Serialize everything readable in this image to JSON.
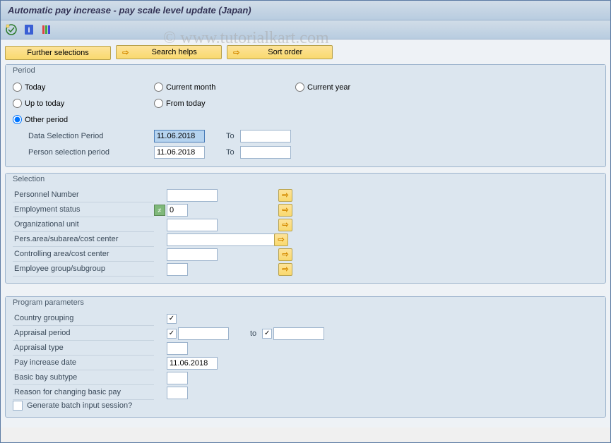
{
  "title": "Automatic pay increase - pay scale level update (Japan)",
  "watermark": "© www.tutorialkart.com",
  "buttons": {
    "further": "Further selections",
    "search": "Search helps",
    "sort": "Sort order"
  },
  "period": {
    "legend": "Period",
    "today": "Today",
    "current_month": "Current month",
    "current_year": "Current year",
    "up_to_today": "Up to today",
    "from_today": "From today",
    "other_period": "Other period",
    "data_sel_label": "Data Selection Period",
    "data_sel_from": "11.06.2018",
    "data_sel_to": "",
    "person_sel_label": "Person selection period",
    "person_sel_from": "11.06.2018",
    "person_sel_to": "",
    "to": "To"
  },
  "selection": {
    "legend": "Selection",
    "personnel_num": "Personnel Number",
    "emp_status": "Employment status",
    "emp_status_val": "0",
    "org_unit": "Organizational unit",
    "pers_area": "Pers.area/subarea/cost center",
    "ctrl_area": "Controlling area/cost center",
    "emp_group": "Employee group/subgroup"
  },
  "program": {
    "legend": "Program parameters",
    "country": "Country grouping",
    "appraisal_period": "Appraisal period",
    "to": "to",
    "appraisal_type": "Appraisal type",
    "pay_increase_date": "Pay increase date",
    "pay_increase_date_val": "11.06.2018",
    "basic_subtype": "Basic bay subtype",
    "reason": "Reason for changing basic pay",
    "generate_batch": "Generate batch input session?"
  },
  "icons": {
    "arrow": "⇨",
    "check": "✓",
    "ne": "≠"
  }
}
